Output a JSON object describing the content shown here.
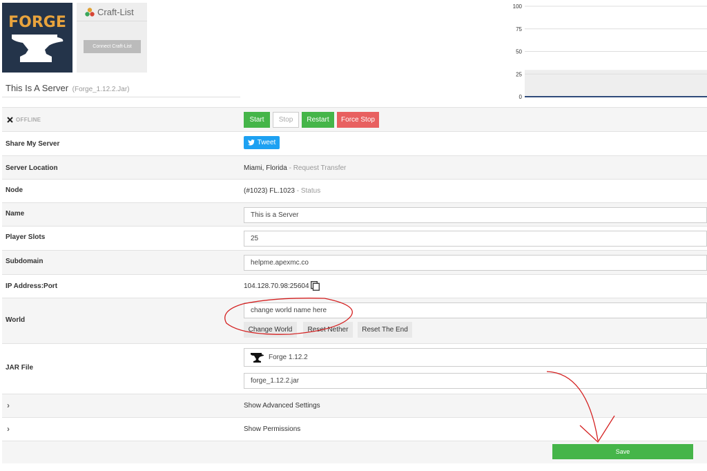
{
  "logo": {
    "text": "FORGE",
    "icon": "anvil-icon"
  },
  "craftlist": {
    "title": "Craft-List",
    "icon": "craftlist-icon",
    "connect_label": "Connect Craft-List"
  },
  "server": {
    "title": "This Is A Server",
    "jar": "(Forge_1.12.2.Jar)"
  },
  "status": {
    "text": "OFFLINE",
    "icon": "x-icon"
  },
  "controls": {
    "start": "Start",
    "stop": "Stop",
    "restart": "Restart",
    "force_stop": "Force Stop"
  },
  "share": {
    "label": "Share My Server",
    "tweet": "Tweet"
  },
  "location": {
    "label": "Server Location",
    "value": "Miami, Florida",
    "sep": " - ",
    "link": "Request Transfer"
  },
  "node": {
    "label": "Node",
    "value": "(#1023) FL.1023",
    "sep": " - ",
    "link": "Status"
  },
  "name": {
    "label": "Name",
    "value": "This is a Server"
  },
  "slots": {
    "label": "Player Slots",
    "value": "25"
  },
  "subdomain": {
    "label": "Subdomain",
    "value": "helpme.apexmc.co"
  },
  "ip": {
    "label": "IP Address:Port",
    "value": "104.128.70.98:25604"
  },
  "world": {
    "label": "World",
    "value": "change world name here",
    "change": "Change World",
    "reset_nether": "Reset Nether",
    "reset_end": "Reset The End"
  },
  "jar": {
    "label": "JAR File",
    "selected": "Forge 1.12.2",
    "filename": "forge_1.12.2.jar"
  },
  "advanced": {
    "label": "Show Advanced Settings"
  },
  "permissions": {
    "label": "Show Permissions"
  },
  "save": {
    "label": "Save"
  },
  "colors": {
    "green": "#45b549",
    "red": "#e86060",
    "blue": "#1da1f2",
    "logo_bg": "#24344a",
    "logo_text": "#e8a33d",
    "annotation": "#d42020"
  },
  "chart_data": {
    "type": "area",
    "yticks": [
      "100",
      "75",
      "50",
      "25",
      "0"
    ],
    "ylim": [
      0,
      100
    ],
    "series": [
      {
        "values": [
          0,
          0
        ]
      }
    ]
  }
}
